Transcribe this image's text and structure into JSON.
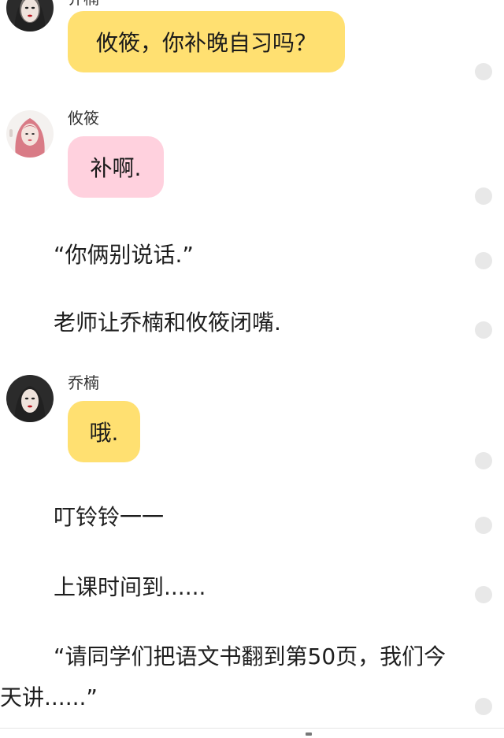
{
  "messages": [
    {
      "speaker": "乔楠",
      "text": "攸筱，你补晚自习吗？"
    },
    {
      "speaker": "攸筱",
      "text": "补啊."
    },
    {
      "speaker": "乔楠",
      "text": "哦."
    }
  ],
  "narration": {
    "line1": "“你俩别说话.”",
    "line2": "老师让乔楠和攸筱闭嘴.",
    "line3": "叮铃铃一一",
    "line4": "上课时间到......",
    "line5": "“请同学们把语文书翻到第50页，我们今天讲......”"
  },
  "colors": {
    "bubble_yellow": "#ffe071",
    "bubble_pink": "#ffd1de",
    "dot": "#e8e8e8"
  },
  "icons": {
    "avatar_1": "avatar-qiaonan",
    "avatar_2": "avatar-youxiao",
    "avatar_3": "avatar-qiaonan",
    "side_dot": "circle-icon"
  }
}
